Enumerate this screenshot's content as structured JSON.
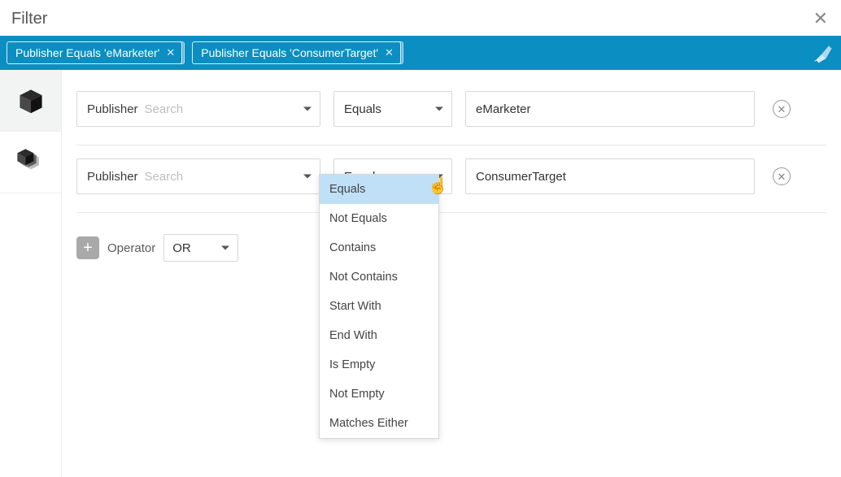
{
  "header": {
    "title": "Filter"
  },
  "chips": [
    {
      "label": "Publisher Equals 'eMarketer'"
    },
    {
      "label": "Publisher Equals 'ConsumerTarget'"
    }
  ],
  "rows": [
    {
      "attribute_label": "Publisher",
      "attribute_placeholder": "Search",
      "operator": "Equals",
      "value": "eMarketer"
    },
    {
      "attribute_label": "Publisher",
      "attribute_placeholder": "Search",
      "operator": "Equals",
      "value": "ConsumerTarget"
    }
  ],
  "operator_section": {
    "label": "Operator",
    "value": "OR"
  },
  "dropdown": {
    "selected": "Equals",
    "options": [
      "Equals",
      "Not Equals",
      "Contains",
      "Not Contains",
      "Start With",
      "End With",
      "Is Empty",
      "Not Empty",
      "Matches Either"
    ]
  }
}
